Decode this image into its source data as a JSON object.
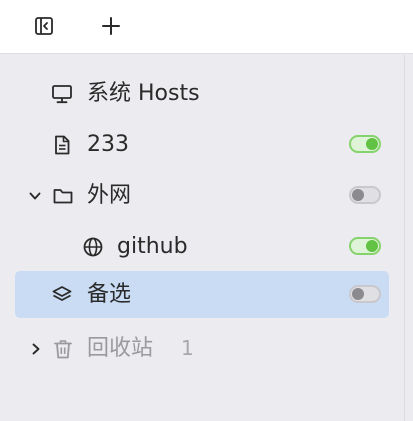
{
  "toolbar": {
    "icons": [
      "sidebar-collapse-icon",
      "plus-icon"
    ]
  },
  "tree": {
    "items": [
      {
        "label": "系统 Hosts",
        "icon": "monitor-icon",
        "toggle": null
      },
      {
        "label": "233",
        "icon": "document-icon",
        "toggle": "on"
      },
      {
        "label": "外网",
        "icon": "folder-icon",
        "expanded": true,
        "toggle": "off"
      },
      {
        "label": "github",
        "icon": "globe-icon",
        "toggle": "on"
      },
      {
        "label": "备选",
        "icon": "layers-icon",
        "toggle": "off",
        "selected": true
      },
      {
        "label": "回收站",
        "icon": "trash-icon",
        "expanded": false,
        "count": "1"
      }
    ]
  },
  "colors": {
    "selected_row": "#c9dcf3",
    "toggle_on": "#62c243",
    "toggle_off": "#8b8a8f",
    "sidebar_bg": "#ecebef"
  }
}
